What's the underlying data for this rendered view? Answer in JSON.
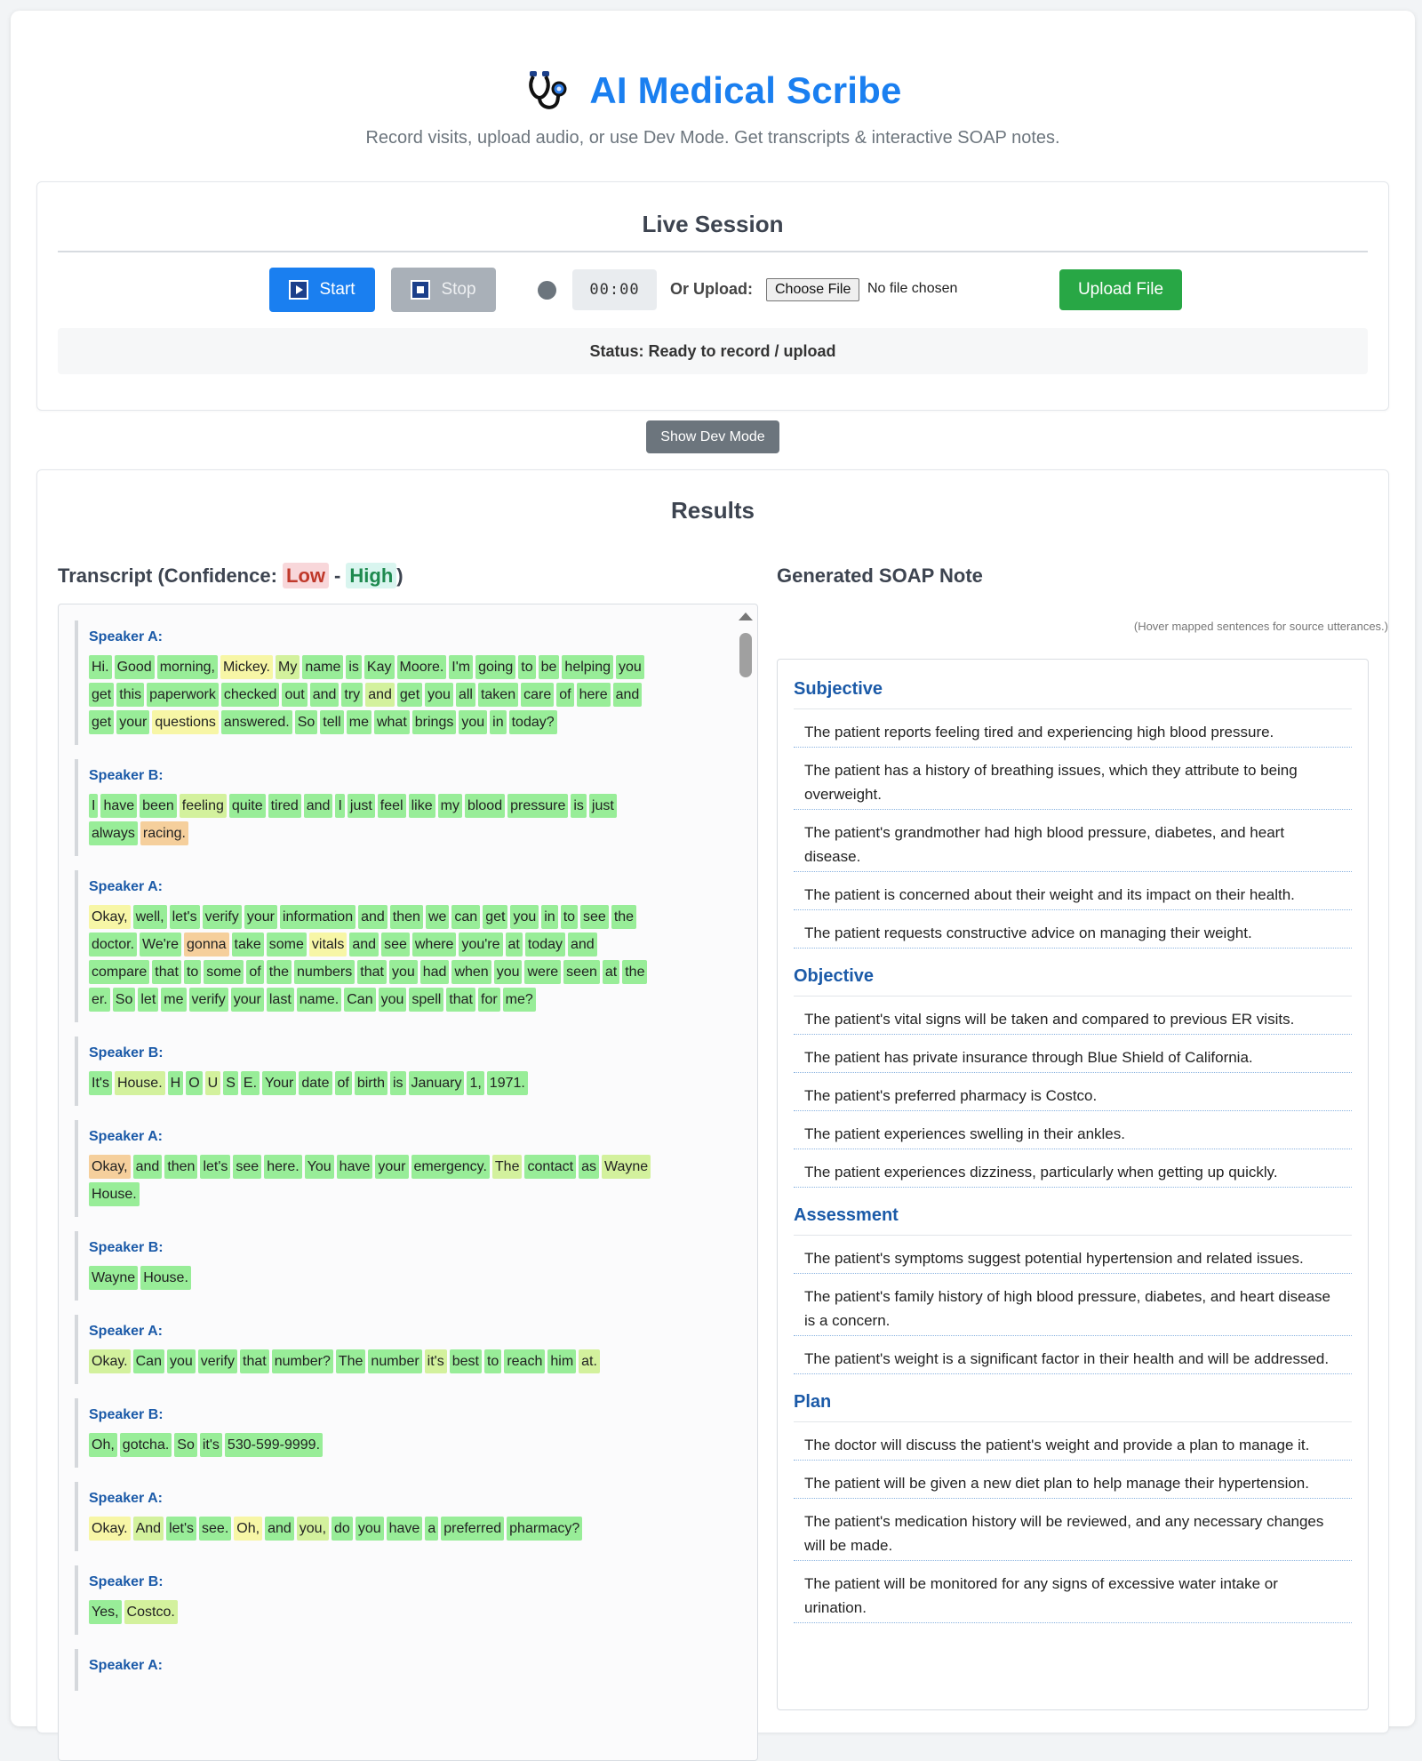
{
  "header": {
    "title": "AI Medical Scribe",
    "subtitle": "Record visits, upload audio, or use Dev Mode. Get transcripts & interactive SOAP notes."
  },
  "live_session": {
    "title": "Live Session",
    "start_label": "Start",
    "stop_label": "Stop",
    "timer": "00:00",
    "upload_label": "Or Upload:",
    "choose_file_label": "Choose File",
    "file_status": "No file chosen",
    "upload_button_label": "Upload File",
    "status": "Status: Ready to record / upload"
  },
  "dev_mode": {
    "button_label": "Show Dev Mode"
  },
  "results": {
    "title": "Results",
    "transcript_title": "Transcript (Confidence:",
    "conf_low": "Low",
    "conf_dash": "-",
    "conf_high": "High",
    "conf_close": ")",
    "soap_title": "Generated SOAP Note",
    "soap_hint": "(Hover mapped sentences for source utterances.)"
  },
  "colors": {
    "accent": "#1a7ff0",
    "success": "#28a745",
    "secondary": "#6c757d",
    "speaker": "#1b5aa8"
  },
  "transcript": [
    {
      "speaker": "Speaker A:",
      "words": [
        [
          "Hi.",
          1
        ],
        [
          "Good",
          1
        ],
        [
          "morning,",
          1
        ],
        [
          "Mickey.",
          3
        ],
        [
          "My",
          2
        ],
        [
          "name",
          1
        ],
        [
          "is",
          1
        ],
        [
          "Kay",
          1
        ],
        [
          "Moore.",
          1
        ],
        [
          "I'm",
          1
        ],
        [
          "going",
          1
        ],
        [
          "to",
          1
        ],
        [
          "be",
          1
        ],
        [
          "helping",
          1
        ],
        [
          "you",
          1
        ],
        [
          "get",
          1
        ],
        [
          "this",
          1
        ],
        [
          "paperwork",
          1
        ],
        [
          "checked",
          1
        ],
        [
          "out",
          1
        ],
        [
          "and",
          1
        ],
        [
          "try",
          1
        ],
        [
          "and",
          2
        ],
        [
          "get",
          1
        ],
        [
          "you",
          1
        ],
        [
          "all",
          1
        ],
        [
          "taken",
          1
        ],
        [
          "care",
          1
        ],
        [
          "of",
          1
        ],
        [
          "here",
          1
        ],
        [
          "and",
          1
        ],
        [
          "get",
          1
        ],
        [
          "your",
          1
        ],
        [
          "questions",
          3
        ],
        [
          "answered.",
          1
        ],
        [
          "So",
          1
        ],
        [
          "tell",
          1
        ],
        [
          "me",
          1
        ],
        [
          "what",
          1
        ],
        [
          "brings",
          1
        ],
        [
          "you",
          1
        ],
        [
          "in",
          1
        ],
        [
          "today?",
          1
        ]
      ]
    },
    {
      "speaker": "Speaker B:",
      "words": [
        [
          "I",
          1
        ],
        [
          "have",
          1
        ],
        [
          "been",
          1
        ],
        [
          "feeling",
          2
        ],
        [
          "quite",
          1
        ],
        [
          "tired",
          1
        ],
        [
          "and",
          1
        ],
        [
          "I",
          1
        ],
        [
          "just",
          1
        ],
        [
          "feel",
          1
        ],
        [
          "like",
          1
        ],
        [
          "my",
          1
        ],
        [
          "blood",
          1
        ],
        [
          "pressure",
          1
        ],
        [
          "is",
          1
        ],
        [
          "just",
          1
        ],
        [
          "always",
          1
        ],
        [
          "racing.",
          4
        ]
      ]
    },
    {
      "speaker": "Speaker A:",
      "words": [
        [
          "Okay,",
          3
        ],
        [
          "well,",
          1
        ],
        [
          "let's",
          1
        ],
        [
          "verify",
          1
        ],
        [
          "your",
          1
        ],
        [
          "information",
          1
        ],
        [
          "and",
          1
        ],
        [
          "then",
          1
        ],
        [
          "we",
          1
        ],
        [
          "can",
          1
        ],
        [
          "get",
          1
        ],
        [
          "you",
          1
        ],
        [
          "in",
          1
        ],
        [
          "to",
          1
        ],
        [
          "see",
          1
        ],
        [
          "the",
          1
        ],
        [
          "doctor.",
          1
        ],
        [
          "We're",
          1
        ],
        [
          "gonna",
          4
        ],
        [
          "take",
          1
        ],
        [
          "some",
          1
        ],
        [
          "vitals",
          3
        ],
        [
          "and",
          1
        ],
        [
          "see",
          1
        ],
        [
          "where",
          1
        ],
        [
          "you're",
          1
        ],
        [
          "at",
          1
        ],
        [
          "today",
          1
        ],
        [
          "and",
          1
        ],
        [
          "compare",
          1
        ],
        [
          "that",
          1
        ],
        [
          "to",
          1
        ],
        [
          "some",
          1
        ],
        [
          "of",
          1
        ],
        [
          "the",
          1
        ],
        [
          "numbers",
          1
        ],
        [
          "that",
          1
        ],
        [
          "you",
          1
        ],
        [
          "had",
          1
        ],
        [
          "when",
          1
        ],
        [
          "you",
          1
        ],
        [
          "were",
          1
        ],
        [
          "seen",
          1
        ],
        [
          "at",
          1
        ],
        [
          "the",
          1
        ],
        [
          "er.",
          1
        ],
        [
          "So",
          1
        ],
        [
          "let",
          1
        ],
        [
          "me",
          1
        ],
        [
          "verify",
          1
        ],
        [
          "your",
          1
        ],
        [
          "last",
          1
        ],
        [
          "name.",
          1
        ],
        [
          "Can",
          1
        ],
        [
          "you",
          1
        ],
        [
          "spell",
          1
        ],
        [
          "that",
          1
        ],
        [
          "for",
          1
        ],
        [
          "me?",
          1
        ]
      ]
    },
    {
      "speaker": "Speaker B:",
      "words": [
        [
          "It's",
          1
        ],
        [
          "House.",
          2
        ],
        [
          "H",
          1
        ],
        [
          "O",
          1
        ],
        [
          "U",
          2
        ],
        [
          "S",
          1
        ],
        [
          "E.",
          1
        ],
        [
          "Your",
          1
        ],
        [
          "date",
          1
        ],
        [
          "of",
          1
        ],
        [
          "birth",
          1
        ],
        [
          "is",
          1
        ],
        [
          "January",
          1
        ],
        [
          "1,",
          1
        ],
        [
          "1971.",
          1
        ]
      ]
    },
    {
      "speaker": "Speaker A:",
      "words": [
        [
          "Okay,",
          4
        ],
        [
          "and",
          1
        ],
        [
          "then",
          1
        ],
        [
          "let's",
          1
        ],
        [
          "see",
          1
        ],
        [
          "here.",
          1
        ],
        [
          "You",
          1
        ],
        [
          "have",
          1
        ],
        [
          "your",
          1
        ],
        [
          "emergency.",
          1
        ],
        [
          "The",
          2
        ],
        [
          "contact",
          1
        ],
        [
          "as",
          1
        ],
        [
          "Wayne",
          2
        ],
        [
          "House.",
          1
        ]
      ]
    },
    {
      "speaker": "Speaker B:",
      "words": [
        [
          "Wayne",
          1
        ],
        [
          "House.",
          1
        ]
      ]
    },
    {
      "speaker": "Speaker A:",
      "words": [
        [
          "Okay.",
          2
        ],
        [
          "Can",
          1
        ],
        [
          "you",
          1
        ],
        [
          "verify",
          1
        ],
        [
          "that",
          1
        ],
        [
          "number?",
          1
        ],
        [
          "The",
          1
        ],
        [
          "number",
          1
        ],
        [
          "it's",
          2
        ],
        [
          "best",
          1
        ],
        [
          "to",
          1
        ],
        [
          "reach",
          1
        ],
        [
          "him",
          1
        ],
        [
          "at.",
          2
        ]
      ]
    },
    {
      "speaker": "Speaker B:",
      "words": [
        [
          "Oh,",
          1
        ],
        [
          "gotcha.",
          1
        ],
        [
          "So",
          1
        ],
        [
          "it's",
          1
        ],
        [
          "530-599-9999.",
          1
        ]
      ]
    },
    {
      "speaker": "Speaker A:",
      "words": [
        [
          "Okay.",
          3
        ],
        [
          "And",
          2
        ],
        [
          "let's",
          1
        ],
        [
          "see.",
          1
        ],
        [
          "Oh,",
          3
        ],
        [
          "and",
          1
        ],
        [
          "you,",
          2
        ],
        [
          "do",
          1
        ],
        [
          "you",
          1
        ],
        [
          "have",
          1
        ],
        [
          "a",
          1
        ],
        [
          "preferred",
          1
        ],
        [
          "pharmacy?",
          1
        ]
      ]
    },
    {
      "speaker": "Speaker B:",
      "words": [
        [
          "Yes,",
          1
        ],
        [
          "Costco.",
          2
        ]
      ]
    },
    {
      "speaker": "Speaker A:",
      "words": []
    }
  ],
  "soap": [
    {
      "heading": "Subjective",
      "items": [
        "The patient reports feeling tired and experiencing high blood pressure.",
        "The patient has a history of breathing issues, which they attribute to being overweight.",
        "The patient's grandmother had high blood pressure, diabetes, and heart disease.",
        "The patient is concerned about their weight and its impact on their health.",
        "The patient requests constructive advice on managing their weight."
      ]
    },
    {
      "heading": "Objective",
      "items": [
        "The patient's vital signs will be taken and compared to previous ER visits.",
        "The patient has private insurance through Blue Shield of California.",
        "The patient's preferred pharmacy is Costco.",
        "The patient experiences swelling in their ankles.",
        "The patient experiences dizziness, particularly when getting up quickly."
      ]
    },
    {
      "heading": "Assessment",
      "items": [
        "The patient's symptoms suggest potential hypertension and related issues.",
        "The patient's family history of high blood pressure, diabetes, and heart disease is a concern.",
        "The patient's weight is a significant factor in their health and will be addressed."
      ]
    },
    {
      "heading": "Plan",
      "items": [
        "The doctor will discuss the patient's weight and provide a plan to manage it.",
        "The patient will be given a new diet plan to help manage their hypertension.",
        "The patient's medication history will be reviewed, and any necessary changes will be made.",
        "The patient will be monitored for any signs of excessive water intake or urination."
      ]
    }
  ]
}
